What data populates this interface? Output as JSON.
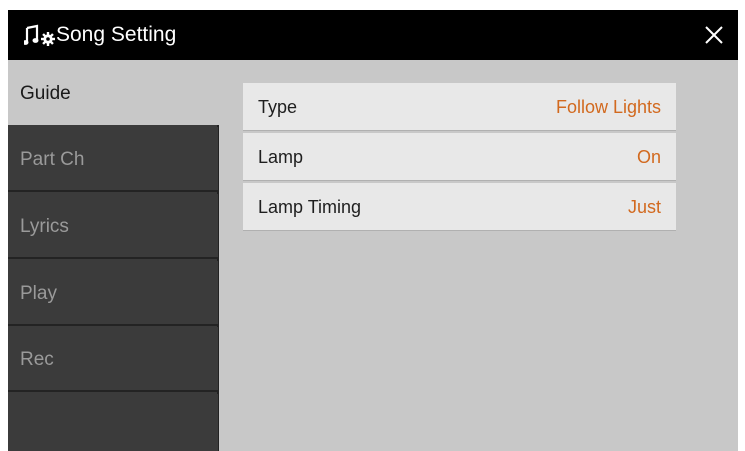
{
  "window": {
    "title": "Song Setting",
    "title_icon": "music-settings-icon",
    "close_icon": "close-icon"
  },
  "sidebar": {
    "tabs": [
      {
        "label": "Guide",
        "active": true
      },
      {
        "label": "Part Ch",
        "active": false
      },
      {
        "label": "Lyrics",
        "active": false
      },
      {
        "label": "Play",
        "active": false
      },
      {
        "label": "Rec",
        "active": false
      }
    ]
  },
  "settings": [
    {
      "label": "Type",
      "value": "Follow Lights"
    },
    {
      "label": "Lamp",
      "value": "On"
    },
    {
      "label": "Lamp Timing",
      "value": "Just"
    }
  ],
  "colors": {
    "title_bar": "#000000",
    "sidebar": "#3b3b3b",
    "content_bg": "#c8c8c8",
    "value_accent": "#d2691e"
  }
}
